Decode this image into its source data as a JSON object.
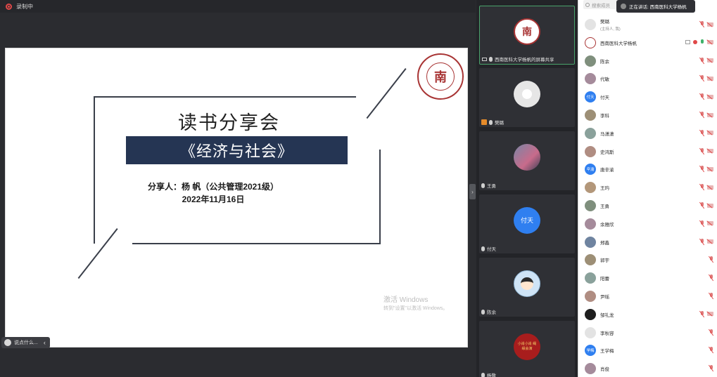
{
  "topbar": {
    "recording_label": "录制中"
  },
  "slide": {
    "title": "读书分享会",
    "book": "《经济与社会》",
    "sharer": "分享人：杨 帆（公共管理2021级）",
    "date": "2022年11月16日",
    "seal_char": "南"
  },
  "watermark": {
    "line1": "激活 Windows",
    "line2": "转到\"设置\"以激活 Windows。"
  },
  "bottom_chip": {
    "label": "说点什么..."
  },
  "video_tiles": [
    {
      "label": "西南医科大学杨帆的屏幕共享",
      "avatar": "seal"
    },
    {
      "label": "樊璐",
      "avatar": "grey"
    },
    {
      "label": "王勇",
      "avatar": "anime"
    },
    {
      "label": "付天",
      "avatar": "blue",
      "avatar_text": "付天"
    },
    {
      "label": "陈余",
      "avatar": "cartoon"
    },
    {
      "label": "杨敬",
      "avatar": "red",
      "avatar_text": "小肖小肖 绳缘会演"
    }
  ],
  "panel": {
    "search_placeholder": "搜索成员",
    "speaking_label": "正在讲话: 西南医科大学杨帆",
    "participants": [
      {
        "name": "樊璐",
        "sub": "(主持人, 我)",
        "av": "grey",
        "icons": [
          "mic-off",
          "cam-off"
        ]
      },
      {
        "name": "西南医科大学杨帆",
        "sub": "",
        "av": "seal",
        "icons": [
          "share",
          "rec",
          "mic-on",
          "cam-off"
        ]
      },
      {
        "name": "陈余",
        "sub": "",
        "av": "photo",
        "icons": [
          "mic-off",
          "cam-off"
        ]
      },
      {
        "name": "代敏",
        "sub": "",
        "av": "photo",
        "icons": [
          "mic-off",
          "cam-off"
        ]
      },
      {
        "name": "付天",
        "sub": "",
        "av": "blue",
        "av_text": "付天",
        "icons": [
          "mic-off",
          "cam-off"
        ]
      },
      {
        "name": "李科",
        "sub": "",
        "av": "photo",
        "icons": [
          "mic-off",
          "cam-off"
        ]
      },
      {
        "name": "马潇潇",
        "sub": "",
        "av": "photo",
        "icons": [
          "mic-off",
          "cam-off"
        ]
      },
      {
        "name": "史鸿斯",
        "sub": "",
        "av": "photo",
        "icons": [
          "mic-off",
          "cam-off"
        ]
      },
      {
        "name": "唐辛渝",
        "sub": "",
        "av": "blue",
        "av_text": "辛渝",
        "icons": [
          "mic-off",
          "cam-off"
        ]
      },
      {
        "name": "王玙",
        "sub": "",
        "av": "photo",
        "icons": [
          "mic-off",
          "cam-off"
        ]
      },
      {
        "name": "王勇",
        "sub": "",
        "av": "photo",
        "icons": [
          "mic-off",
          "cam-off"
        ]
      },
      {
        "name": "余雅欣",
        "sub": "",
        "av": "photo",
        "icons": [
          "mic-off",
          "cam-off"
        ]
      },
      {
        "name": "郑鑫",
        "sub": "",
        "av": "photo",
        "icons": [
          "mic-off",
          "cam-off"
        ]
      },
      {
        "name": "郭宇",
        "sub": "",
        "av": "photo",
        "icons": [
          "mic-off"
        ]
      },
      {
        "name": "阳蕾",
        "sub": "",
        "av": "photo",
        "icons": [
          "mic-off"
        ]
      },
      {
        "name": "尹瑶",
        "sub": "",
        "av": "photo",
        "icons": [
          "mic-off"
        ]
      },
      {
        "name": "邹礼龙",
        "sub": "",
        "av": "dark",
        "icons": [
          "mic-off",
          "cam-off"
        ]
      },
      {
        "name": "李秋容",
        "sub": "",
        "av": "grey",
        "icons": [
          "mic-off"
        ]
      },
      {
        "name": "王学梅",
        "sub": "",
        "av": "blue",
        "av_text": "学梅",
        "icons": [
          "mic-off"
        ]
      },
      {
        "name": "肖俊",
        "sub": "",
        "av": "photo",
        "icons": [
          "mic-off"
        ]
      }
    ]
  }
}
